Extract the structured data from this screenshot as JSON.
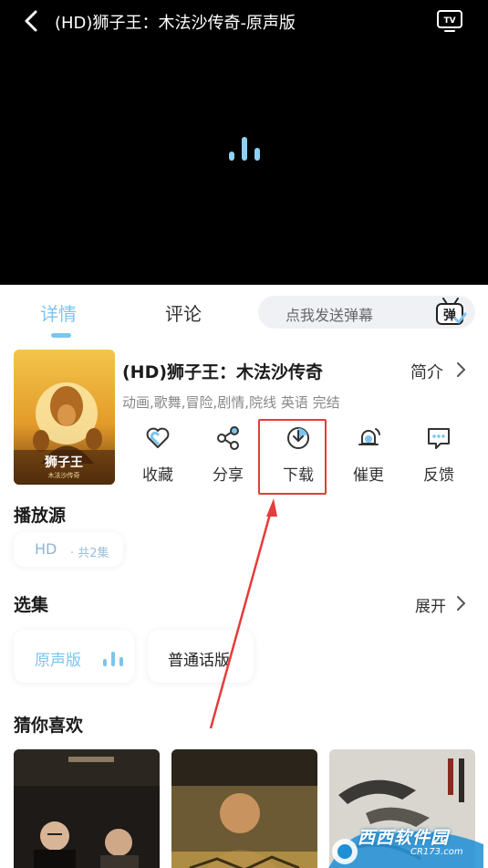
{
  "player": {
    "title": "(HD)狮子王：木法沙传奇-原声版"
  },
  "tabs": {
    "detail": "详情",
    "comment": "评论"
  },
  "danmaku": {
    "placeholder": "点我发送弹幕",
    "icon_text": "弹"
  },
  "movie": {
    "title": "(HD)狮子王：木法沙传奇",
    "intro_link": "简介",
    "tags": "动画,歌舞,冒险,剧情,院线 英语 完结",
    "poster_title": "狮子王",
    "poster_subtitle": "木法沙传奇"
  },
  "actions": {
    "favorite": "收藏",
    "share": "分享",
    "download": "下载",
    "remind": "催更",
    "feedback": "反馈"
  },
  "source": {
    "section_title": "播放源",
    "label": "HD",
    "count": "· 共2集"
  },
  "episodes": {
    "section_title": "选集",
    "expand": "展开",
    "items": [
      "原声版",
      "普通话版"
    ]
  },
  "recommend": {
    "section_title": "猜你喜欢"
  },
  "watermark": {
    "text": "西西软件园",
    "url": "CR173.com"
  },
  "colors": {
    "accent": "#7cc4ef",
    "highlight": "#e53b3b",
    "player_bg": "#000000"
  }
}
